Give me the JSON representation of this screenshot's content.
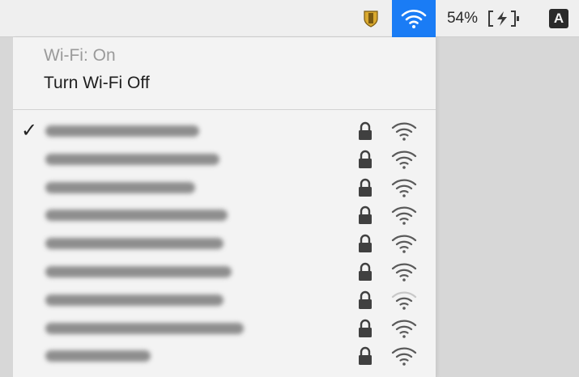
{
  "menubar": {
    "battery_percent": "54%",
    "input_source": "A",
    "icons": [
      "shield-icon",
      "wifi-icon",
      "battery-charging-icon",
      "input-source-icon"
    ],
    "accent_color": "#1a7cf5"
  },
  "menu": {
    "status": "Wi-Fi: On",
    "toggle": "Turn Wi-Fi Off",
    "networks": [
      {
        "name_blurred": true,
        "connected": true,
        "secured": true,
        "signal_level": 3
      },
      {
        "name_blurred": true,
        "connected": false,
        "secured": true,
        "signal_level": 3
      },
      {
        "name_blurred": true,
        "connected": false,
        "secured": true,
        "signal_level": 3
      },
      {
        "name_blurred": true,
        "connected": false,
        "secured": true,
        "signal_level": 3
      },
      {
        "name_blurred": true,
        "connected": false,
        "secured": true,
        "signal_level": 3
      },
      {
        "name_blurred": true,
        "connected": false,
        "secured": true,
        "signal_level": 3
      },
      {
        "name_blurred": true,
        "connected": false,
        "secured": true,
        "signal_level": 2
      },
      {
        "name_blurred": true,
        "connected": false,
        "secured": true,
        "signal_level": 3
      },
      {
        "name_blurred": true,
        "connected": false,
        "secured": true,
        "signal_level": 3
      }
    ]
  }
}
